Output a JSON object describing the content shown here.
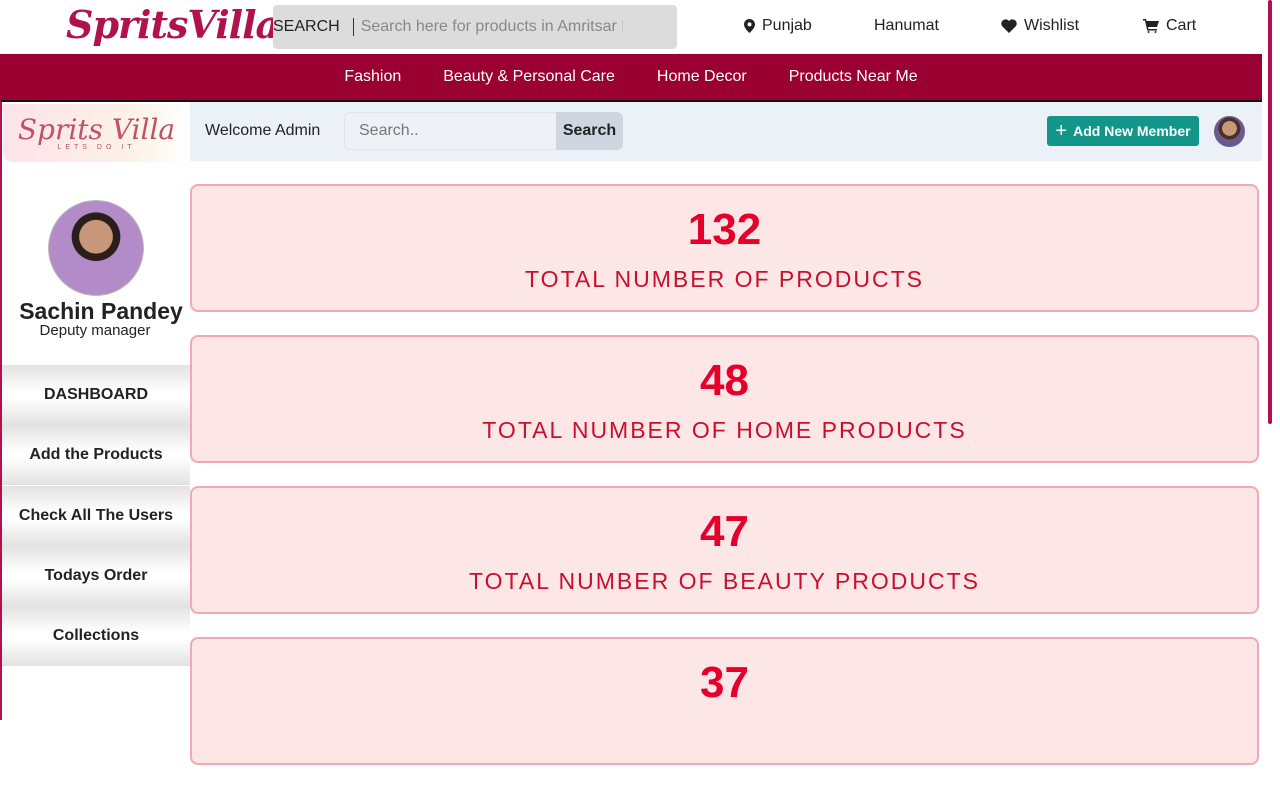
{
  "header": {
    "brand": "SpritsVilla",
    "search_label": "SEARCH",
    "search_placeholder": "Search here for products in Amritsar I T",
    "location": "Punjab",
    "user": "Hanumat",
    "wishlist": "Wishlist",
    "cart": "Cart"
  },
  "categories": [
    "Fashion",
    "Beauty & Personal Care",
    "Home Decor",
    "Products Near Me"
  ],
  "admin": {
    "logo_text": "Sprits Villa",
    "logo_tagline": "LETS DO IT",
    "welcome": "Welcome Admin",
    "search_placeholder": "Search..",
    "search_button": "Search",
    "add_member": "Add New Member"
  },
  "profile": {
    "name": "Sachin Pandey",
    "role": "Deputy manager"
  },
  "menu": [
    "DASHBOARD",
    "Add the Products",
    "Check All The Users",
    "Todays Order",
    "Collections"
  ],
  "stats": [
    {
      "value": "132",
      "label": "TOTAL NUMBER OF PRODUCTS"
    },
    {
      "value": "48",
      "label": "TOTAL NUMBER OF HOME PRODUCTS"
    },
    {
      "value": "47",
      "label": "TOTAL NUMBER OF BEAUTY PRODUCTS"
    },
    {
      "value": "37",
      "label": ""
    }
  ],
  "colors": {
    "brand": "#9b0033",
    "accent": "#12968a",
    "stat_text": "#e4002b",
    "card_bg": "#fde6e6"
  }
}
